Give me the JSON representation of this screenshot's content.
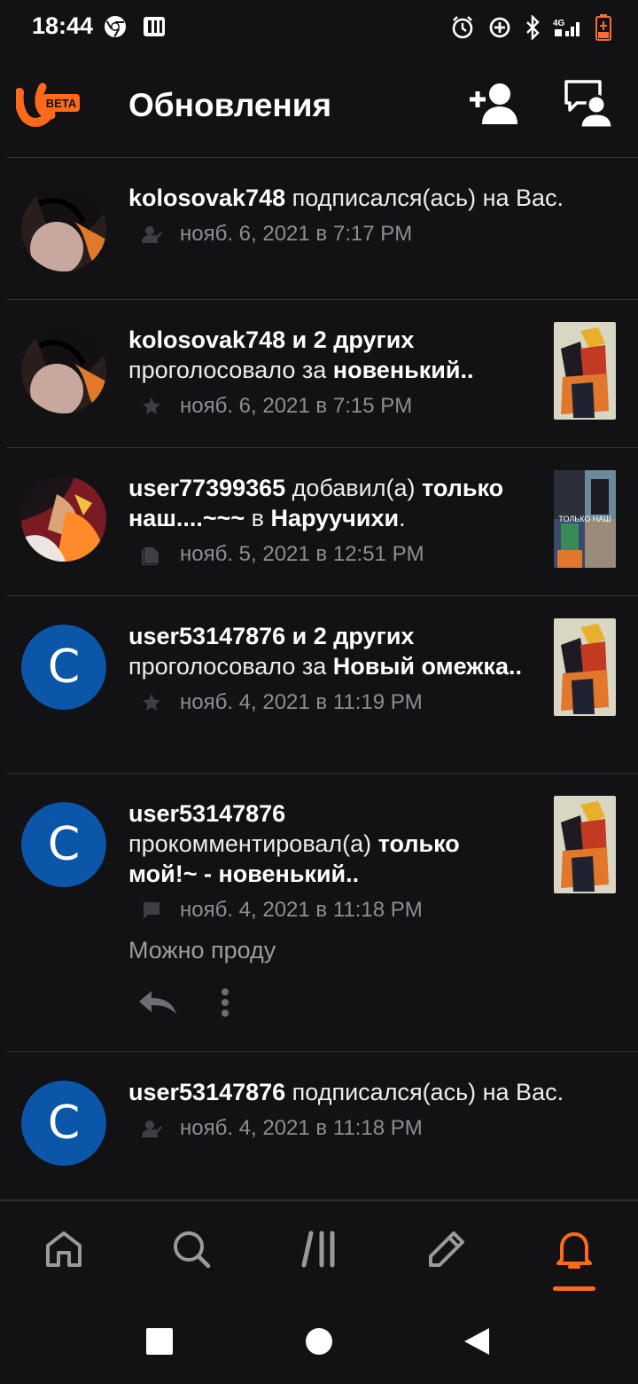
{
  "status_bar": {
    "time": "18:44"
  },
  "app_bar": {
    "logo_badge": "BETA",
    "title": "Обновления"
  },
  "feed": [
    {
      "avatar": "image",
      "user": "kolosovak748",
      "text": " подписался(ась) на Вас.",
      "meta_icon": "follow-icon",
      "timestamp": "нояб. 6, 2021 в 7:17 PM"
    },
    {
      "avatar": "image",
      "user": "kolosovak748 и 2 других",
      "text": "проголосовало за ",
      "target": "новенький..",
      "meta_icon": "star-icon",
      "timestamp": "нояб. 6, 2021 в 7:15 PM"
    },
    {
      "avatar": "image",
      "user": "user77399365",
      "text": " добавил(а) ",
      "target": "только наш....~~~",
      "text2": " в ",
      "target2": "Наруучихи",
      "text3": ".",
      "meta_icon": "library-icon",
      "timestamp": "нояб. 5, 2021 в 12:51 PM"
    },
    {
      "avatar_letter": "C",
      "user": "user53147876 и 2 других",
      "text": "проголосовало за ",
      "target": "Новый омежка..",
      "meta_icon": "star-icon",
      "timestamp": "нояб. 4, 2021 в 11:19 PM"
    },
    {
      "avatar_letter": "C",
      "user": "user53147876",
      "text": "прокомментировал(а) ",
      "target": "только мой!~ - новенький..",
      "meta_icon": "comment-icon",
      "timestamp": "нояб. 4, 2021 в 11:18 PM",
      "comment": "Можно проду"
    },
    {
      "avatar_letter": "C",
      "user": "user53147876",
      "text": " подписался(ась) на Вас.",
      "meta_icon": "follow-icon",
      "timestamp": "нояб. 4, 2021 в 11:18 PM"
    }
  ],
  "colors": {
    "background": "#121114",
    "accent": "#ff6a1a",
    "avatar_blue": "#0b56a8",
    "meta_gray": "#8e8d93"
  }
}
